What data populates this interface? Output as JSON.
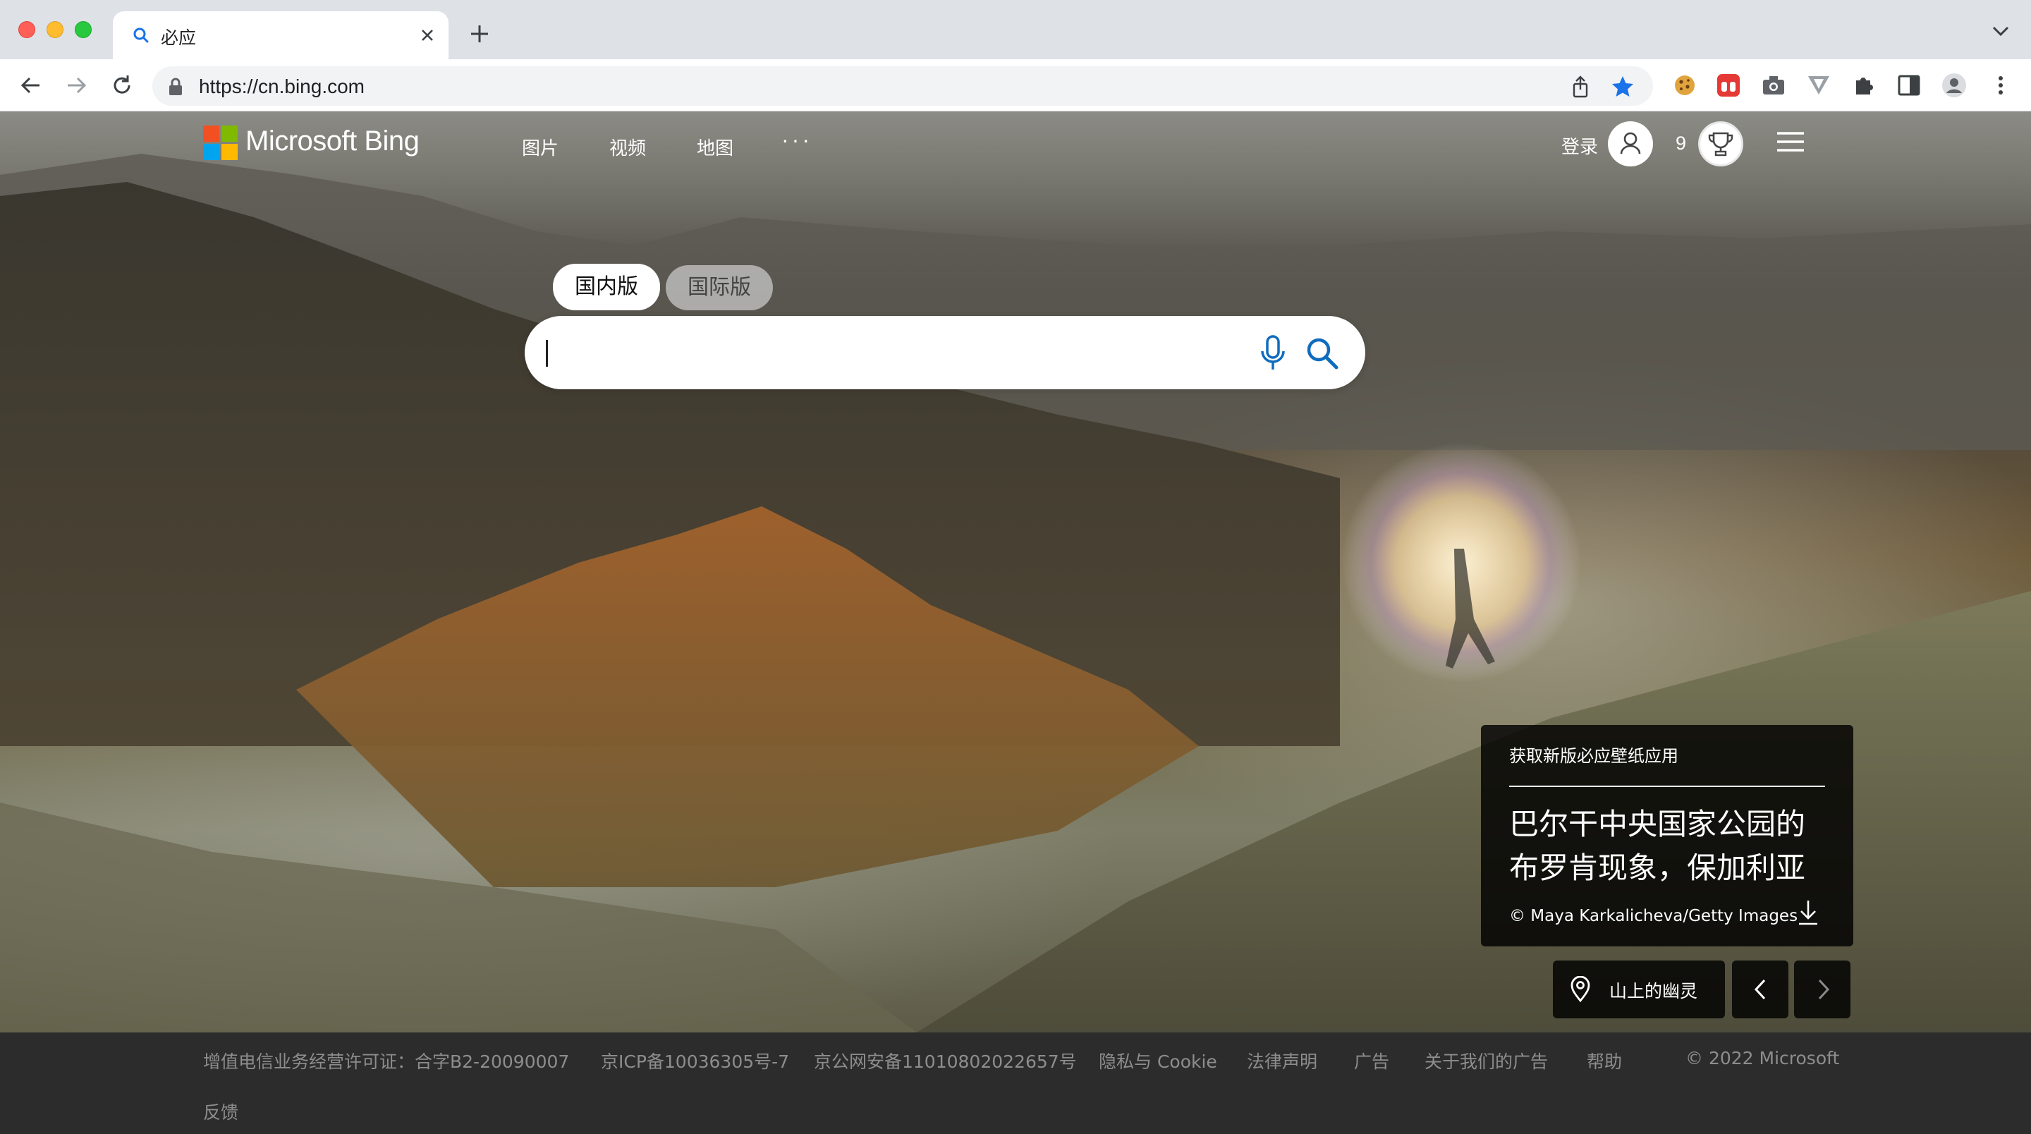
{
  "browser": {
    "tab_title": "必应",
    "url": "https://cn.bing.com"
  },
  "header": {
    "brand": "Microsoft Bing",
    "nav": [
      "图片",
      "视频",
      "地图"
    ],
    "more": "···",
    "signin": "登录",
    "reward_points": "9"
  },
  "search": {
    "tabs": [
      "国内版",
      "国际版"
    ],
    "active_tab": "国内版",
    "query": ""
  },
  "image_info": {
    "cta": "获取新版必应壁纸应用",
    "title": "巴尔干中央国家公园的布罗肯现象，保加利亚",
    "credit": "© Maya Karkalicheva/Getty Images",
    "location_label": "山上的幽灵"
  },
  "footer": {
    "links": [
      "增值电信业务经营许可证：合字B2-20090007",
      "京ICP备10036305号-7",
      "京公网安备11010802022657号",
      "隐私与 Cookie",
      "法律声明",
      "广告",
      "关于我们的广告",
      "帮助"
    ],
    "copyright": "© 2022 Microsoft",
    "feedback": "反馈"
  },
  "colors": {
    "logo_red": "#f25022",
    "logo_green": "#7fba00",
    "logo_blue": "#00a4ef",
    "logo_yellow": "#ffb900",
    "accent_blue": "#1a73e8",
    "bing_teal": "#0f6cbd"
  },
  "icons": [
    "search-icon",
    "close-icon",
    "plus-icon",
    "chevron-down-icon",
    "back-icon",
    "forward-icon",
    "reload-icon",
    "lock-icon",
    "share-icon",
    "star-icon",
    "cookie-icon",
    "extension-icon",
    "camera-icon",
    "vimeo-icon",
    "puzzle-icon",
    "sidepanel-icon",
    "profile-icon",
    "kebab-icon",
    "mic-icon",
    "trophy-icon",
    "hamburger-icon",
    "download-icon",
    "location-pin-icon",
    "chevron-left-icon",
    "chevron-right-icon"
  ]
}
